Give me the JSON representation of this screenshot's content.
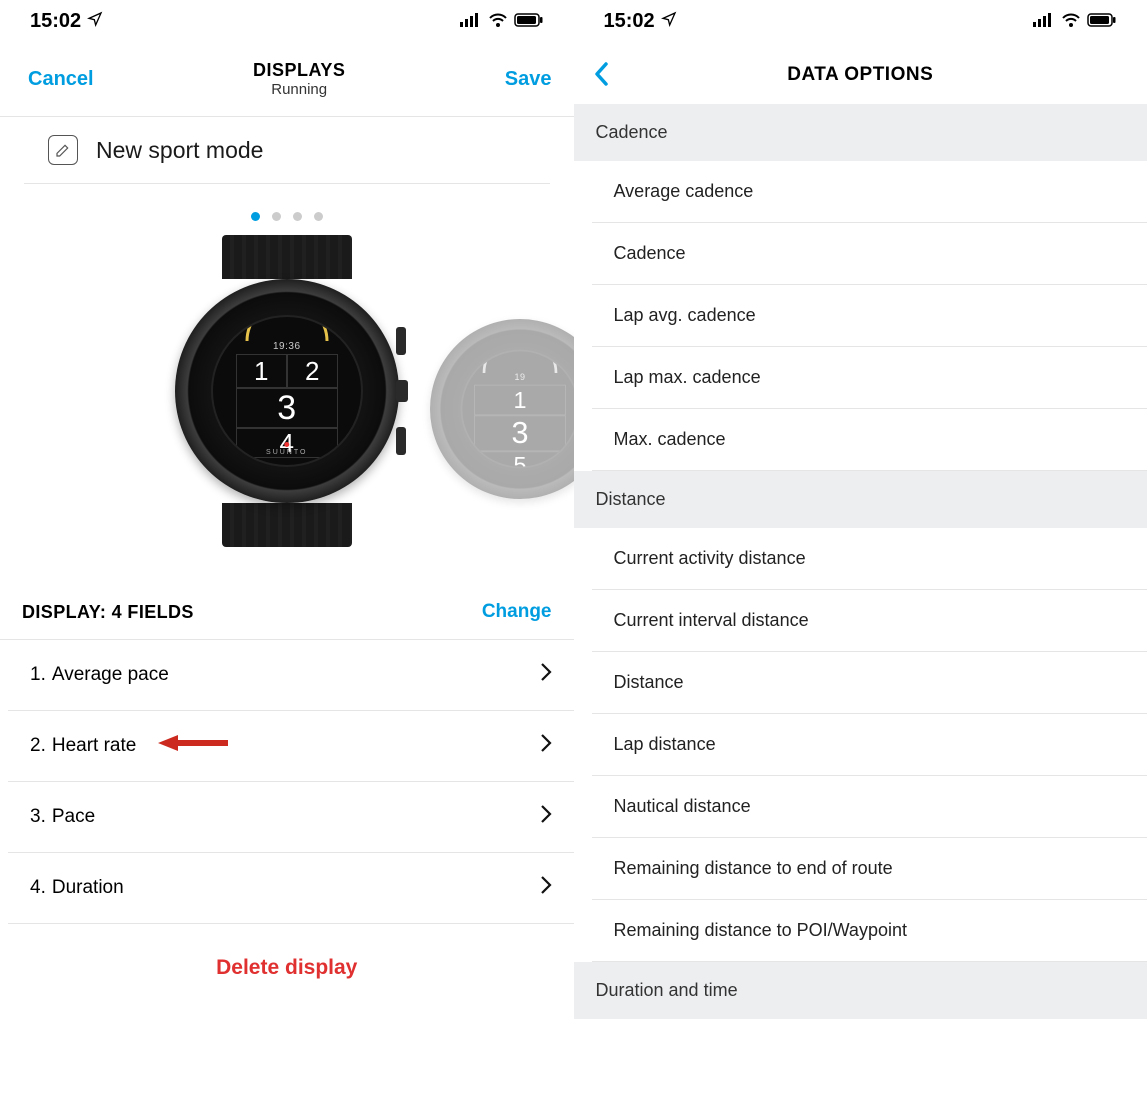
{
  "status": {
    "time": "15:02",
    "loc_icon": "location-icon",
    "signal_icon": "cellular-signal-icon",
    "wifi_icon": "wifi-icon",
    "battery_icon": "battery-icon"
  },
  "left": {
    "header": {
      "cancel": "Cancel",
      "title": "DISPLAYS",
      "subtitle": "Running",
      "save": "Save"
    },
    "mode_row": {
      "text": "New sport mode"
    },
    "page_dots": {
      "count": 4,
      "active_index": 0
    },
    "watch": {
      "time": "19:36",
      "cells": [
        "1",
        "2",
        "3",
        "4"
      ],
      "brand": "SUUNTO"
    },
    "watch_peek": {
      "time": "19",
      "cells": [
        "1",
        "3",
        "5"
      ]
    },
    "display_section": {
      "label": "DISPLAY: 4 FIELDS",
      "change": "Change"
    },
    "fields": [
      {
        "num": "1.",
        "name": "Average pace"
      },
      {
        "num": "2.",
        "name": "Heart rate"
      },
      {
        "num": "3.",
        "name": "Pace"
      },
      {
        "num": "4.",
        "name": "Duration"
      }
    ],
    "delete_label": "Delete display",
    "arrow_points_to_index": 1
  },
  "right": {
    "header": {
      "title": "DATA OPTIONS"
    },
    "groups": [
      {
        "title": "Cadence",
        "options": [
          "Average cadence",
          "Cadence",
          "Lap avg. cadence",
          "Lap max. cadence",
          "Max. cadence"
        ]
      },
      {
        "title": "Distance",
        "options": [
          "Current activity distance",
          "Current interval distance",
          "Distance",
          "Lap distance",
          "Nautical distance",
          "Remaining distance to end of route",
          "Remaining distance to POI/Waypoint"
        ]
      },
      {
        "title": "Duration and time",
        "options": []
      }
    ]
  }
}
